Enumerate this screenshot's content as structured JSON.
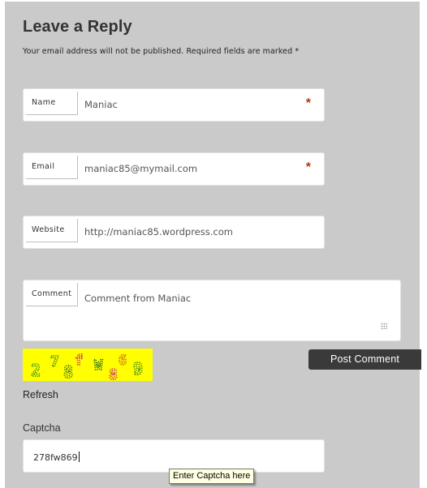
{
  "heading": "Leave a Reply",
  "notice": "Your email address will not be published. Required fields are marked *",
  "fields": {
    "name": {
      "label": "Name",
      "value": "Maniac",
      "required_mark": "*"
    },
    "email": {
      "label": "Email",
      "value": "maniac85@mymail.com",
      "required_mark": "*"
    },
    "website": {
      "label": "Website",
      "value": "http://maniac85.wordpress.com"
    },
    "comment": {
      "label": "Comment",
      "value": "Comment from Maniac"
    }
  },
  "post_button": "Post Comment",
  "captcha": {
    "image_code": "278fw869",
    "image_glyphs": [
      "2",
      "7",
      "8",
      "f",
      "W",
      "8",
      "6",
      "9"
    ],
    "refresh_link": "Refresh",
    "label": "Captcha",
    "value": "278fw869",
    "tooltip": "Enter Captcha here"
  },
  "colors": {
    "panel_bg": "#cacaca",
    "required_mark": "#b03a17",
    "button_bg": "#3a3a3a",
    "captcha_bg": "#ffff00",
    "tooltip_bg": "#ffffe1"
  }
}
